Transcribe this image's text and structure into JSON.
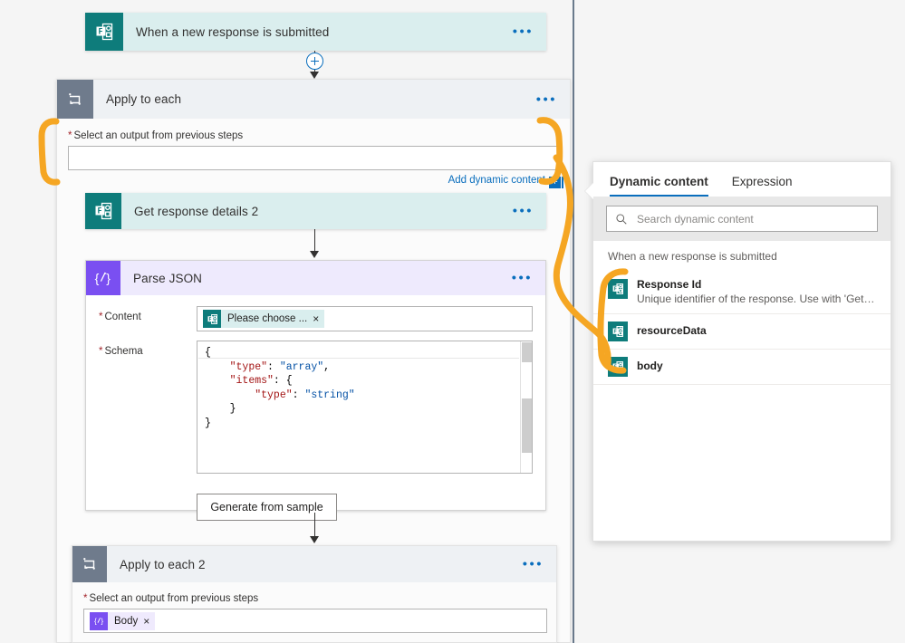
{
  "trigger": {
    "title": "When a new response is submitted",
    "icon": "microsoft-forms-icon",
    "more": "•••"
  },
  "scope1": {
    "title": "Apply to each",
    "icon": "loop-icon",
    "more": "•••",
    "field_label": "Select an output from previous steps",
    "field_required_marker": "*",
    "field_value": "",
    "add_dynamic_content": "Add dynamic content",
    "add_dynamic_plus": "+"
  },
  "get_response": {
    "title": "Get response details 2",
    "icon": "microsoft-forms-icon",
    "more": "•••"
  },
  "parse_json": {
    "title": "Parse JSON",
    "icon": "parse-json-icon",
    "more": "•••",
    "content_label": "Content",
    "content_required_marker": "*",
    "content_token": "Please choose ...",
    "content_token_icon": "microsoft-forms-icon",
    "content_token_remove": "×",
    "schema_label": "Schema",
    "schema_required_marker": "*",
    "schema_lines": [
      {
        "indent": 0,
        "parts": [
          {
            "t": "{",
            "c": "plain"
          }
        ]
      },
      {
        "indent": 1,
        "parts": [
          {
            "t": "\"type\"",
            "c": "key"
          },
          {
            "t": ": ",
            "c": "plain"
          },
          {
            "t": "\"array\"",
            "c": "val"
          },
          {
            "t": ",",
            "c": "plain"
          }
        ]
      },
      {
        "indent": 1,
        "parts": [
          {
            "t": "\"items\"",
            "c": "key"
          },
          {
            "t": ": {",
            "c": "plain"
          }
        ]
      },
      {
        "indent": 2,
        "parts": [
          {
            "t": "\"type\"",
            "c": "key"
          },
          {
            "t": ": ",
            "c": "plain"
          },
          {
            "t": "\"string\"",
            "c": "val"
          }
        ]
      },
      {
        "indent": 1,
        "parts": [
          {
            "t": "}",
            "c": "plain"
          }
        ]
      },
      {
        "indent": 0,
        "parts": [
          {
            "t": "}",
            "c": "plain"
          }
        ]
      }
    ],
    "generate_button": "Generate from sample"
  },
  "scope2": {
    "title": "Apply to each 2",
    "icon": "loop-icon",
    "more": "•••",
    "field_label": "Select an output from previous steps",
    "field_required_marker": "*",
    "token": "Body",
    "token_icon": "parse-json-icon",
    "token_remove": "×"
  },
  "dynamic_panel": {
    "tabs": [
      {
        "label": "Dynamic content",
        "active": true
      },
      {
        "label": "Expression",
        "active": false
      }
    ],
    "search_placeholder": "Search dynamic content",
    "search_value": "",
    "search_icon": "search-icon",
    "group_title": "When a new response is submitted",
    "items": [
      {
        "name": "Response Id",
        "description": "Unique identifier of the response. Use with 'Get response de...",
        "icon": "microsoft-forms-icon"
      },
      {
        "name": "resourceData",
        "description": "",
        "icon": "microsoft-forms-icon"
      },
      {
        "name": "body",
        "description": "",
        "icon": "microsoft-forms-icon"
      }
    ]
  },
  "annotations": {
    "color": "#f5a623",
    "shapes": [
      "left-bracket-around-select-output-field",
      "right-bracket-around-add-dynamic-content",
      "curve-connecting-to-dynamic-content-items",
      "bracket-around-dynamic-content-items"
    ]
  },
  "colors": {
    "forms_teal": "#0e7c7b",
    "forms_teal_header": "#daeeee",
    "parse_json_purple": "#7a4ff1",
    "parse_json_header": "#eeeafd",
    "control_grey": "#6f7b8c",
    "control_header": "#eef1f4",
    "link_blue": "#0a6ebd",
    "required_red": "#a4262c",
    "annotation_orange": "#f5a623"
  }
}
